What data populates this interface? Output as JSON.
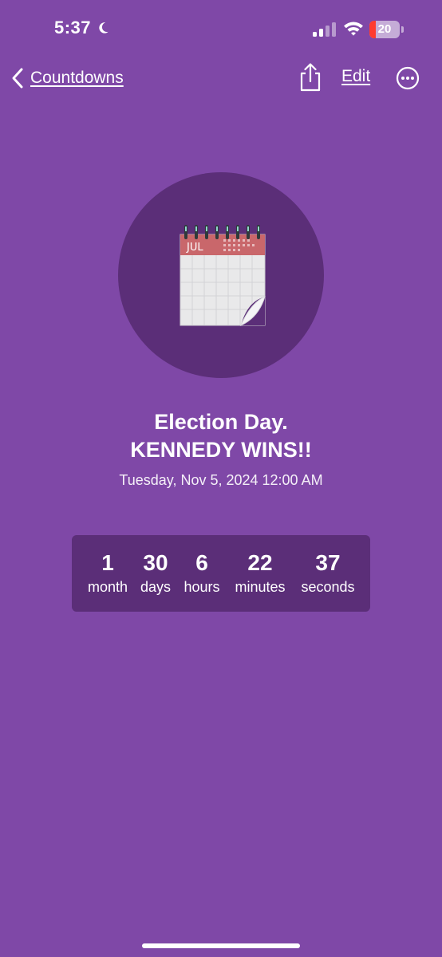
{
  "status_bar": {
    "time": "5:37",
    "battery_percent": "20",
    "battery_level": 0.2,
    "icons": [
      "moon-icon",
      "signal-icon",
      "wifi-icon",
      "battery-icon"
    ]
  },
  "nav": {
    "back_label": "Countdowns",
    "edit_label": "Edit",
    "icons": [
      "chevron-left-icon",
      "share-icon",
      "more-icon"
    ]
  },
  "event": {
    "icon": "calendar-icon",
    "calendar_month": "JUL",
    "title_line1": "Election Day.",
    "title_line2": "KENNEDY WINS!!",
    "date": "Tuesday, Nov 5, 2024 12:00 AM"
  },
  "countdown": {
    "units": [
      {
        "value": "1",
        "label": "month"
      },
      {
        "value": "30",
        "label": "days"
      },
      {
        "value": "6",
        "label": "hours"
      },
      {
        "value": "22",
        "label": "minutes"
      },
      {
        "value": "37",
        "label": "seconds"
      }
    ]
  },
  "colors": {
    "background": "#7f48a7",
    "panel": "#5b2e78",
    "text": "#ffffff",
    "battery_low": "#ff3b30",
    "calendar_header": "#c9676b"
  }
}
